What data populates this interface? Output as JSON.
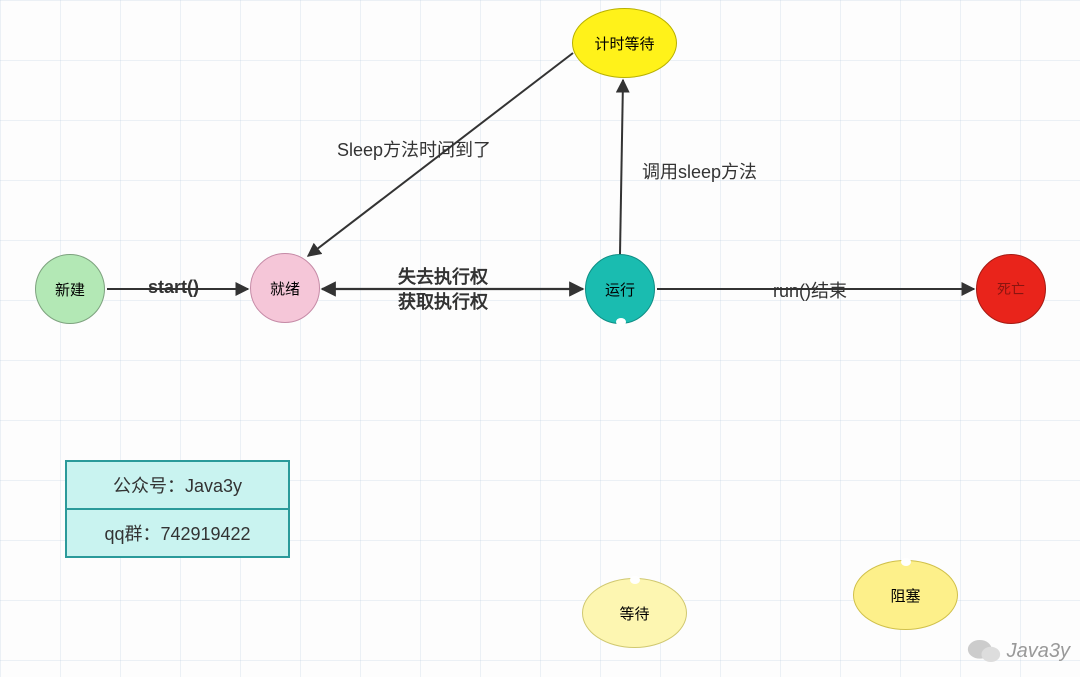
{
  "nodes": {
    "new": "新建",
    "ready": "就绪",
    "run": "运行",
    "dead": "死亡",
    "timed_wait": "计时等待",
    "wait": "等待",
    "block": "阻塞"
  },
  "edges": {
    "start": "start()",
    "lose_exec": "失去执行权",
    "gain_exec": "获取执行权",
    "sleep_timeout": "Sleep方法时间到了",
    "call_sleep": "调用sleep方法",
    "run_end": "run()结束"
  },
  "info": {
    "line1": "公众号：Java3y",
    "line2": "qq群：742919422"
  },
  "watermark": "Java3y"
}
